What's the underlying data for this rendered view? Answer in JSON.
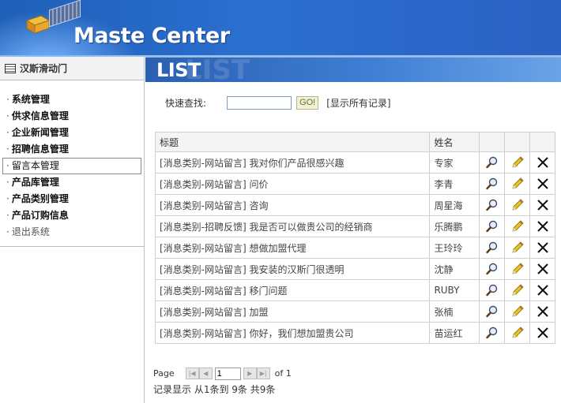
{
  "app": {
    "title": "Maste Center"
  },
  "sidebar": {
    "heading": "汉斯滑动门",
    "items": [
      {
        "label": "系统管理",
        "active": false
      },
      {
        "label": "供求信息管理",
        "active": false
      },
      {
        "label": "企业新闻管理",
        "active": false
      },
      {
        "label": "招聘信息管理",
        "active": false
      },
      {
        "label": "留言本管理",
        "active": true
      },
      {
        "label": "产品库管理",
        "active": false
      },
      {
        "label": "产品类别管理",
        "active": false
      },
      {
        "label": "产品订购信息",
        "active": false
      },
      {
        "label": "退出系统",
        "active": false
      }
    ]
  },
  "main": {
    "banner_title": "LIST",
    "banner_ghost": "LIST",
    "search": {
      "label": "快速查找:",
      "value": "",
      "go_label": "GO!",
      "show_all_label": "[显示所有记录]"
    },
    "table": {
      "headers": {
        "title": "标题",
        "name": "姓名"
      },
      "rows": [
        {
          "title": "[消息类别-网站留言] 我对你们产品很感兴趣",
          "name": "专家"
        },
        {
          "title": "[消息类别-网站留言] 问价",
          "name": "李青"
        },
        {
          "title": "[消息类别-网站留言] 咨询",
          "name": "周星海"
        },
        {
          "title": "[消息类别-招聘反馈] 我是否可以做贵公司的经销商",
          "name": "乐腾鹏"
        },
        {
          "title": "[消息类别-网站留言] 想做加盟代理",
          "name": "王玲玲"
        },
        {
          "title": "[消息类别-网站留言] 我安装的汉斯门很透明",
          "name": "沈静"
        },
        {
          "title": "[消息类别-网站留言] 移门问题",
          "name": "RUBY"
        },
        {
          "title": "[消息类别-网站留言] 加盟",
          "name": "张楠"
        },
        {
          "title": "[消息类别-网站留言] 你好，我们想加盟贵公司",
          "name": "苗运红"
        }
      ],
      "row_icons": {
        "view": "magnifier-icon",
        "edit": "pencil-icon",
        "delete": "x-icon"
      }
    },
    "pager": {
      "page_label": "Page",
      "current_page": "1",
      "of_label": "of 1"
    },
    "record_info": "记录显示 从1条到 9条 共9条"
  },
  "colors": {
    "header_blue": "#2b6fd0",
    "pencil_yellow": "#e8c51c"
  }
}
